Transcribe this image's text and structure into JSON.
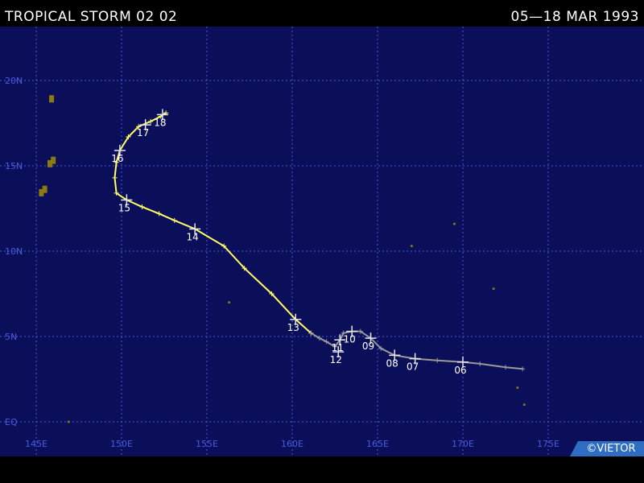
{
  "header": {
    "title": "TROPICAL STORM 02 02",
    "dates": "05—18 MAR 1993"
  },
  "credit": "©VIETOR",
  "colors": {
    "ocean": "#0b0f5a",
    "grid": "#4a5bd8",
    "land": "#8a7a12",
    "track_storm": "#ffff66",
    "track_depression": "#9a9a9a",
    "labels": "#ffffff"
  },
  "lat_labels": [
    "20N",
    "15N",
    "10N",
    "5N",
    "EQ"
  ],
  "lon_labels": [
    "145E",
    "150E",
    "155E",
    "160E",
    "165E",
    "170E",
    "175E"
  ],
  "track": {
    "storm_points": [
      [
        161.1,
        5.2
      ],
      [
        160.2,
        6.0
      ],
      [
        158.8,
        7.5
      ],
      [
        157.2,
        9.0
      ],
      [
        156.0,
        10.3
      ],
      [
        154.3,
        11.3
      ],
      [
        153.1,
        11.8
      ],
      [
        152.2,
        12.2
      ],
      [
        151.2,
        12.6
      ],
      [
        150.3,
        13.0
      ],
      [
        149.7,
        13.4
      ],
      [
        149.6,
        14.3
      ],
      [
        149.7,
        15.2
      ],
      [
        149.9,
        15.9
      ],
      [
        150.4,
        16.7
      ],
      [
        151.0,
        17.3
      ],
      [
        151.7,
        17.6
      ],
      [
        152.3,
        17.9
      ],
      [
        152.6,
        18.1
      ]
    ],
    "depression_points": [
      [
        173.5,
        3.1
      ],
      [
        172.5,
        3.2
      ],
      [
        171.0,
        3.4
      ],
      [
        170.0,
        3.5
      ],
      [
        168.5,
        3.6
      ],
      [
        167.2,
        3.7
      ],
      [
        166.0,
        3.9
      ],
      [
        165.2,
        4.3
      ],
      [
        164.6,
        4.9
      ],
      [
        164.0,
        5.3
      ],
      [
        163.5,
        5.3
      ],
      [
        163.0,
        5.2
      ],
      [
        162.8,
        4.8
      ],
      [
        162.5,
        4.4
      ],
      [
        162.0,
        4.7
      ],
      [
        161.6,
        4.9
      ],
      [
        161.1,
        5.2
      ]
    ],
    "day_markers": [
      {
        "label": "06",
        "lon": 170.0,
        "lat": 3.5
      },
      {
        "label": "07",
        "lon": 167.2,
        "lat": 3.7
      },
      {
        "label": "08",
        "lon": 166.0,
        "lat": 3.9
      },
      {
        "label": "09",
        "lon": 164.6,
        "lat": 4.9
      },
      {
        "label": "10",
        "lon": 163.5,
        "lat": 5.3
      },
      {
        "label": "11",
        "lon": 162.8,
        "lat": 4.8
      },
      {
        "label": "12",
        "lon": 162.7,
        "lat": 4.1
      },
      {
        "label": "13",
        "lon": 160.2,
        "lat": 6.0
      },
      {
        "label": "14",
        "lon": 154.3,
        "lat": 11.3
      },
      {
        "label": "15",
        "lon": 150.3,
        "lat": 13.0
      },
      {
        "label": "16",
        "lon": 149.9,
        "lat": 15.9
      },
      {
        "label": "17",
        "lon": 151.4,
        "lat": 17.4
      },
      {
        "label": "18",
        "lon": 152.4,
        "lat": 18.0
      }
    ]
  }
}
